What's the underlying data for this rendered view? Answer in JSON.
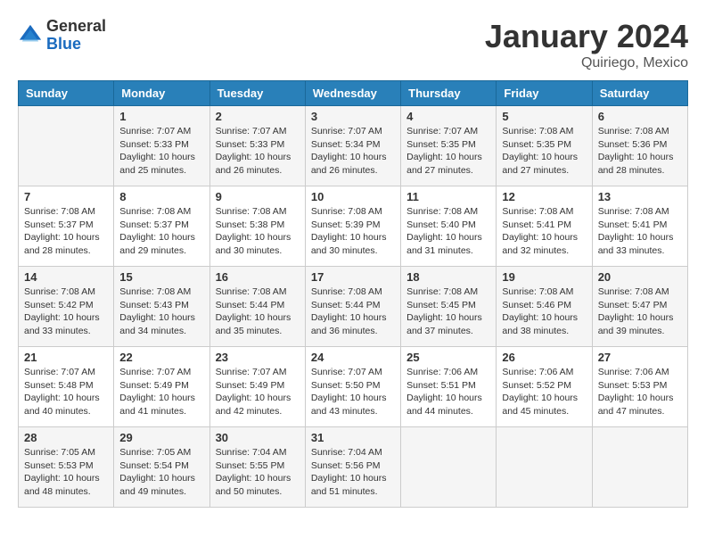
{
  "header": {
    "logo_general": "General",
    "logo_blue": "Blue",
    "month_title": "January 2024",
    "location": "Quiriego, Mexico"
  },
  "days_of_week": [
    "Sunday",
    "Monday",
    "Tuesday",
    "Wednesday",
    "Thursday",
    "Friday",
    "Saturday"
  ],
  "weeks": [
    [
      {
        "day": "",
        "info": ""
      },
      {
        "day": "1",
        "info": "Sunrise: 7:07 AM\nSunset: 5:33 PM\nDaylight: 10 hours\nand 25 minutes."
      },
      {
        "day": "2",
        "info": "Sunrise: 7:07 AM\nSunset: 5:33 PM\nDaylight: 10 hours\nand 26 minutes."
      },
      {
        "day": "3",
        "info": "Sunrise: 7:07 AM\nSunset: 5:34 PM\nDaylight: 10 hours\nand 26 minutes."
      },
      {
        "day": "4",
        "info": "Sunrise: 7:07 AM\nSunset: 5:35 PM\nDaylight: 10 hours\nand 27 minutes."
      },
      {
        "day": "5",
        "info": "Sunrise: 7:08 AM\nSunset: 5:35 PM\nDaylight: 10 hours\nand 27 minutes."
      },
      {
        "day": "6",
        "info": "Sunrise: 7:08 AM\nSunset: 5:36 PM\nDaylight: 10 hours\nand 28 minutes."
      }
    ],
    [
      {
        "day": "7",
        "info": "Sunrise: 7:08 AM\nSunset: 5:37 PM\nDaylight: 10 hours\nand 28 minutes."
      },
      {
        "day": "8",
        "info": "Sunrise: 7:08 AM\nSunset: 5:37 PM\nDaylight: 10 hours\nand 29 minutes."
      },
      {
        "day": "9",
        "info": "Sunrise: 7:08 AM\nSunset: 5:38 PM\nDaylight: 10 hours\nand 30 minutes."
      },
      {
        "day": "10",
        "info": "Sunrise: 7:08 AM\nSunset: 5:39 PM\nDaylight: 10 hours\nand 30 minutes."
      },
      {
        "day": "11",
        "info": "Sunrise: 7:08 AM\nSunset: 5:40 PM\nDaylight: 10 hours\nand 31 minutes."
      },
      {
        "day": "12",
        "info": "Sunrise: 7:08 AM\nSunset: 5:41 PM\nDaylight: 10 hours\nand 32 minutes."
      },
      {
        "day": "13",
        "info": "Sunrise: 7:08 AM\nSunset: 5:41 PM\nDaylight: 10 hours\nand 33 minutes."
      }
    ],
    [
      {
        "day": "14",
        "info": "Sunrise: 7:08 AM\nSunset: 5:42 PM\nDaylight: 10 hours\nand 33 minutes."
      },
      {
        "day": "15",
        "info": "Sunrise: 7:08 AM\nSunset: 5:43 PM\nDaylight: 10 hours\nand 34 minutes."
      },
      {
        "day": "16",
        "info": "Sunrise: 7:08 AM\nSunset: 5:44 PM\nDaylight: 10 hours\nand 35 minutes."
      },
      {
        "day": "17",
        "info": "Sunrise: 7:08 AM\nSunset: 5:44 PM\nDaylight: 10 hours\nand 36 minutes."
      },
      {
        "day": "18",
        "info": "Sunrise: 7:08 AM\nSunset: 5:45 PM\nDaylight: 10 hours\nand 37 minutes."
      },
      {
        "day": "19",
        "info": "Sunrise: 7:08 AM\nSunset: 5:46 PM\nDaylight: 10 hours\nand 38 minutes."
      },
      {
        "day": "20",
        "info": "Sunrise: 7:08 AM\nSunset: 5:47 PM\nDaylight: 10 hours\nand 39 minutes."
      }
    ],
    [
      {
        "day": "21",
        "info": "Sunrise: 7:07 AM\nSunset: 5:48 PM\nDaylight: 10 hours\nand 40 minutes."
      },
      {
        "day": "22",
        "info": "Sunrise: 7:07 AM\nSunset: 5:49 PM\nDaylight: 10 hours\nand 41 minutes."
      },
      {
        "day": "23",
        "info": "Sunrise: 7:07 AM\nSunset: 5:49 PM\nDaylight: 10 hours\nand 42 minutes."
      },
      {
        "day": "24",
        "info": "Sunrise: 7:07 AM\nSunset: 5:50 PM\nDaylight: 10 hours\nand 43 minutes."
      },
      {
        "day": "25",
        "info": "Sunrise: 7:06 AM\nSunset: 5:51 PM\nDaylight: 10 hours\nand 44 minutes."
      },
      {
        "day": "26",
        "info": "Sunrise: 7:06 AM\nSunset: 5:52 PM\nDaylight: 10 hours\nand 45 minutes."
      },
      {
        "day": "27",
        "info": "Sunrise: 7:06 AM\nSunset: 5:53 PM\nDaylight: 10 hours\nand 47 minutes."
      }
    ],
    [
      {
        "day": "28",
        "info": "Sunrise: 7:05 AM\nSunset: 5:53 PM\nDaylight: 10 hours\nand 48 minutes."
      },
      {
        "day": "29",
        "info": "Sunrise: 7:05 AM\nSunset: 5:54 PM\nDaylight: 10 hours\nand 49 minutes."
      },
      {
        "day": "30",
        "info": "Sunrise: 7:04 AM\nSunset: 5:55 PM\nDaylight: 10 hours\nand 50 minutes."
      },
      {
        "day": "31",
        "info": "Sunrise: 7:04 AM\nSunset: 5:56 PM\nDaylight: 10 hours\nand 51 minutes."
      },
      {
        "day": "",
        "info": ""
      },
      {
        "day": "",
        "info": ""
      },
      {
        "day": "",
        "info": ""
      }
    ]
  ]
}
